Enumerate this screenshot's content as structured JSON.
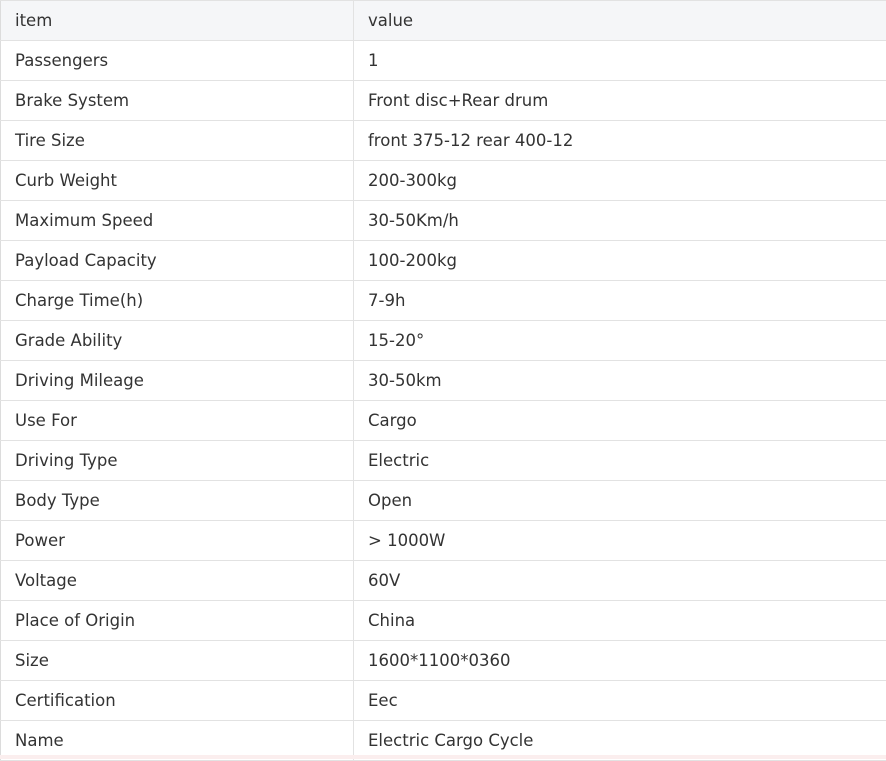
{
  "table": {
    "headers": [
      "item",
      "value"
    ],
    "rows": [
      [
        "Passengers",
        "1"
      ],
      [
        "Brake System",
        "Front disc+Rear drum"
      ],
      [
        "Tire Size",
        "front 375-12 rear 400-12"
      ],
      [
        "Curb Weight",
        "200-300kg"
      ],
      [
        "Maximum Speed",
        "30-50Km/h"
      ],
      [
        "Payload Capacity",
        "100-200kg"
      ],
      [
        "Charge Time(h)",
        "7-9h"
      ],
      [
        "Grade Ability",
        "15-20°"
      ],
      [
        "Driving Mileage",
        "30-50km"
      ],
      [
        "Use For",
        "Cargo"
      ],
      [
        "Driving Type",
        "Electric"
      ],
      [
        "Body Type",
        "Open"
      ],
      [
        "Power",
        "> 1000W"
      ],
      [
        "Voltage",
        "60V"
      ],
      [
        "Place of Origin",
        "China"
      ],
      [
        "Size",
        "1600*1100*0360"
      ],
      [
        "Certification",
        "Eec"
      ],
      [
        "Name",
        "Electric Cargo Cycle"
      ]
    ]
  },
  "colors": {
    "header_bg": "#f5f6f8",
    "border": "#e2e2e2",
    "text": "#333333"
  }
}
